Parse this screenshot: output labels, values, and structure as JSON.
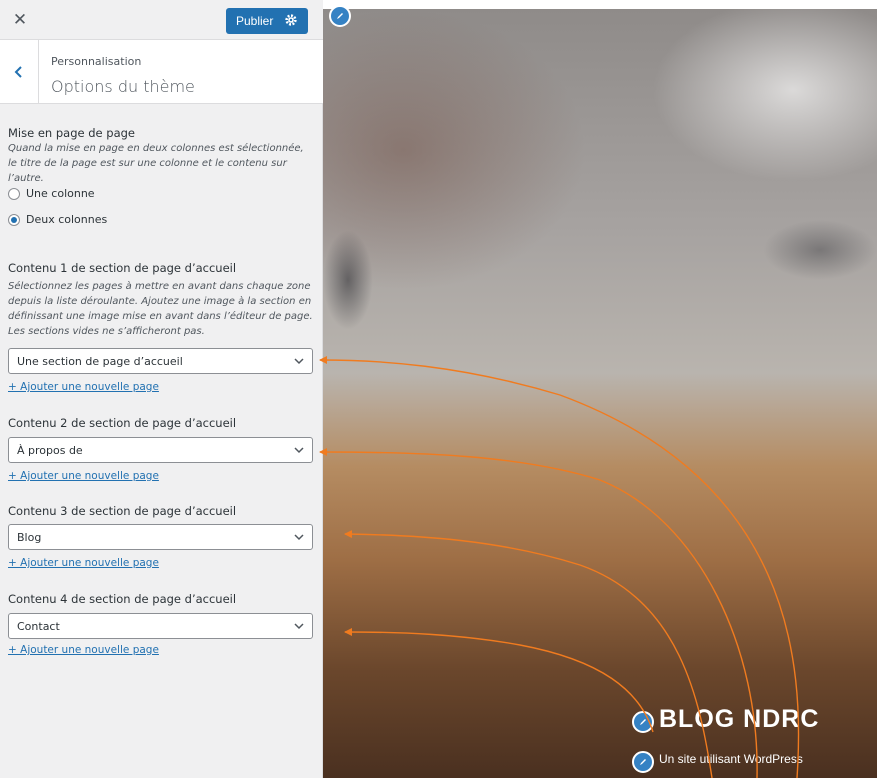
{
  "topbar": {
    "close_glyph": "✕",
    "publish_label": "Publier"
  },
  "section": {
    "breadcrumb": "Personnalisation",
    "title": "Options du thème"
  },
  "layout_option": {
    "title": "Mise en page de page",
    "description": "Quand la mise en page en deux colonnes est sélectionnée, le titre de la page est sur une colonne et le contenu sur l’autre.",
    "options": [
      {
        "label": "Une colonne",
        "checked": false
      },
      {
        "label": "Deux colonnes",
        "checked": true
      }
    ]
  },
  "homepage_sections": [
    {
      "title": "Contenu 1 de section de page d’accueil",
      "description": "Sélectionnez les pages à mettre en avant dans chaque zone depuis la liste déroulante. Ajoutez une image à la section en définissant une image mise en avant dans l’éditeur de page. Les sections vides ne s’afficheront pas.",
      "selected": "Une section de page d’accueil",
      "add_link": "+ Ajouter une nouvelle page"
    },
    {
      "title": "Contenu 2 de section de page d’accueil",
      "selected": "À propos de",
      "add_link": "+ Ajouter une nouvelle page"
    },
    {
      "title": "Contenu 3 de section de page d’accueil",
      "selected": "Blog",
      "add_link": "+ Ajouter une nouvelle page"
    },
    {
      "title": "Contenu 4 de section de page d’accueil",
      "selected": "Contact",
      "add_link": "+ Ajouter une nouvelle page"
    }
  ],
  "preview": {
    "site_title": "BLOG NDRC",
    "tagline": "Un site utilisant WordPress"
  },
  "icons": {
    "close": "close-icon",
    "publish_settings": "gear-icon",
    "back": "chevron-left-icon",
    "select_arrow": "chevron-down-icon",
    "edit_shortcut": "pencil-icon"
  },
  "colors": {
    "accent": "#2271b1",
    "annotation_arrow": "#f07b1f",
    "sidebar_bg": "#f0f0f1"
  }
}
